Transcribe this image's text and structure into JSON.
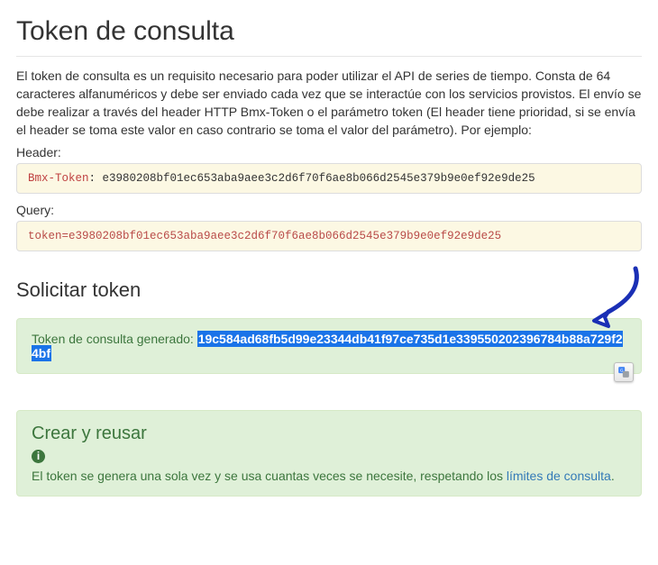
{
  "heading": "Token de consulta",
  "intro": "El token de consulta es un requisito necesario para poder utilizar el API de series de tiempo. Consta de 64 caracteres alfanuméricos y debe ser enviado cada vez que se interactúe con los servicios provistos. El envío se debe realizar a través del header HTTP Bmx-Token o el parámetro token (El header tiene prioridad, si se envía el header se toma este valor en caso contrario se toma el valor del parámetro). Por ejemplo:",
  "header_example": {
    "label": "Header:",
    "key": "Bmx-Token",
    "sep": ": ",
    "value": "e3980208bf01ec653aba9aee3c2d6f70f6ae8b066d2545e379b9e0ef92e9de25"
  },
  "query_example": {
    "label": "Query:",
    "line": "token=e3980208bf01ec653aba9aee3c2d6f70f6ae8b066d2545e379b9e0ef92e9de25"
  },
  "request_heading": "Solicitar token",
  "generated": {
    "label": "Token de consulta generado: ",
    "token": "19c584ad68fb5d99e23344db41f97ce735d1e339550202396784b88a729f24bf"
  },
  "info": {
    "title": "Crear y reusar",
    "text_prefix": "El token se genera una sola vez y se usa cuantas veces se necesite, respetando los ",
    "link_text": "límites de consulta",
    "text_suffix": "."
  }
}
